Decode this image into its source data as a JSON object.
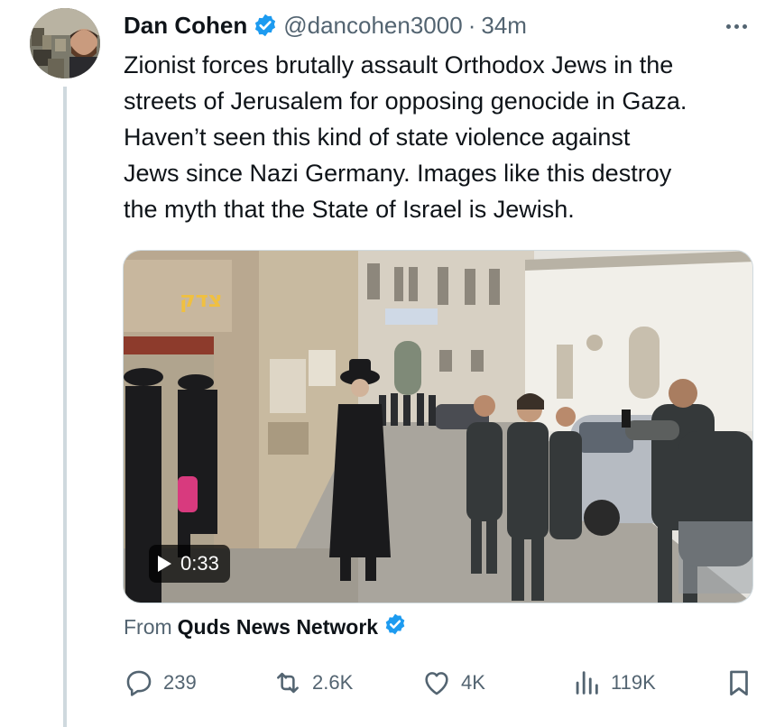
{
  "tweet": {
    "author": {
      "display_name": "Dan Cohen",
      "handle": "@dancohen3000",
      "verified": true,
      "avatar_icon": "profile-photo"
    },
    "separator": "·",
    "timestamp": "34m",
    "more_icon": "ellipsis-icon",
    "text_lines": [
      "Zionist forces brutally assault Orthodox Jews in the",
      "streets of Jerusalem for opposing genocide in Gaza.",
      "Haven’t seen this kind of state violence against",
      "Jews since Nazi Germany. Images like this destroy",
      "the myth that the State of Israel is Jewish."
    ],
    "media": {
      "type": "video",
      "duration": "0:33",
      "play_icon": "play-icon"
    },
    "source": {
      "prefix": "From",
      "name": "Quds News Network",
      "verified": true
    },
    "actions": {
      "reply": {
        "icon": "reply-icon",
        "count": "239"
      },
      "repost": {
        "icon": "repost-icon",
        "count": "2.6K"
      },
      "like": {
        "icon": "heart-icon",
        "count": "4K"
      },
      "views": {
        "icon": "views-icon",
        "count": "119K"
      },
      "bookmark": {
        "icon": "bookmark-icon"
      }
    }
  },
  "colors": {
    "text_primary": "#0f1419",
    "text_secondary": "#536471",
    "verified_blue": "#1d9bf0",
    "thread_line": "#cfd9de"
  }
}
